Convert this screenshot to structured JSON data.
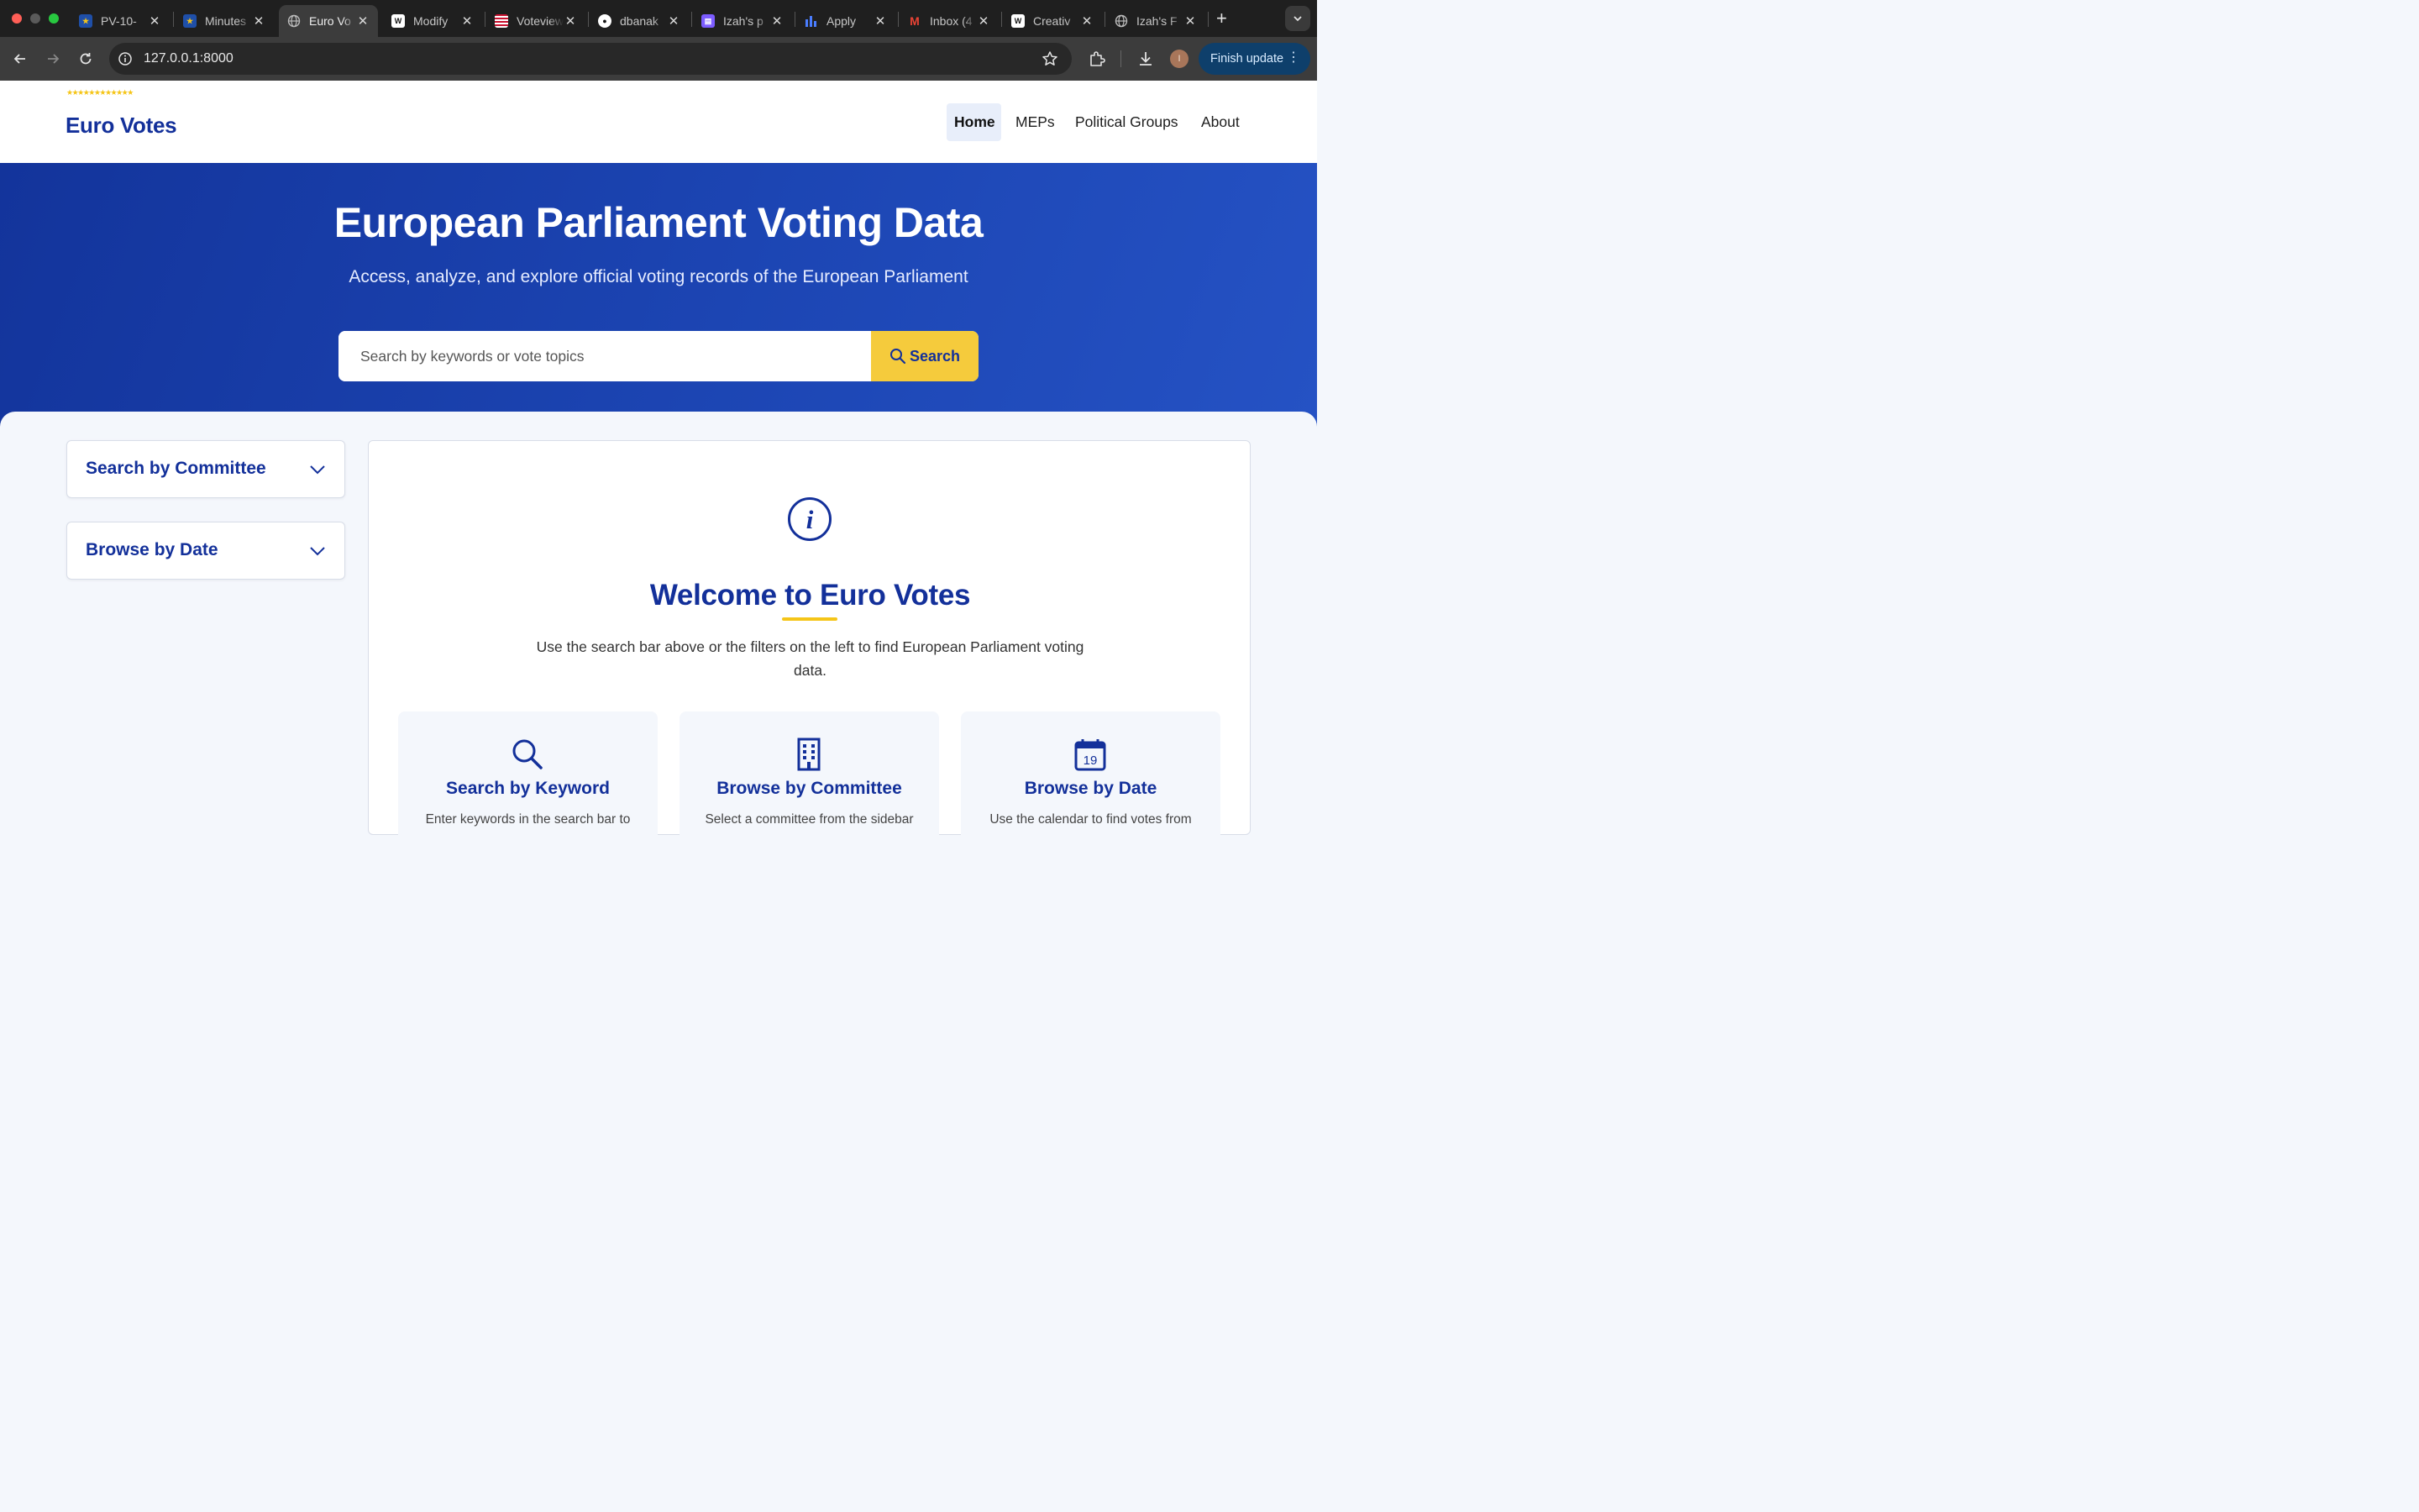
{
  "browser": {
    "tabs": [
      {
        "title": "PV-10-",
        "icon": "eu-flag-icon"
      },
      {
        "title": "Minutes",
        "icon": "eu-flag-icon"
      },
      {
        "title": "Euro Vo",
        "icon": "globe-icon",
        "active": true
      },
      {
        "title": "Modify",
        "icon": "webflow-icon"
      },
      {
        "title": "Voteview",
        "icon": "us-flag-icon"
      },
      {
        "title": "dbanak",
        "icon": "github-icon"
      },
      {
        "title": "Izah's p",
        "icon": "calendar-app-icon"
      },
      {
        "title": "Apply",
        "icon": "bar-chart-icon"
      },
      {
        "title": "Inbox (4",
        "icon": "gmail-icon"
      },
      {
        "title": "Creativ",
        "icon": "webflow-icon"
      },
      {
        "title": "Izah's F",
        "icon": "globe-icon"
      }
    ],
    "new_tab": "+",
    "url": "127.0.0.1:8000",
    "update_button": "Finish update"
  },
  "site": {
    "brand": "Euro Votes",
    "nav": [
      {
        "label": "Home",
        "active": true
      },
      {
        "label": "MEPs"
      },
      {
        "label": "Political Groups"
      },
      {
        "label": "About"
      }
    ]
  },
  "hero": {
    "title": "European Parliament Voting Data",
    "subtitle": "Access, analyze, and explore official voting records of the European Parliament",
    "search_placeholder": "Search by keywords or vote topics",
    "search_button": "Search"
  },
  "sidebar": {
    "sections": [
      {
        "title": "Search by Committee"
      },
      {
        "title": "Browse by Date"
      }
    ]
  },
  "welcome": {
    "title": "Welcome to Euro Votes",
    "text": "Use the search bar above or the filters on the left to find European Parliament voting data.",
    "cards": [
      {
        "title": "Search by Keyword",
        "text": "Enter keywords in the search bar to",
        "icon": "search-icon"
      },
      {
        "title": "Browse by Committee",
        "text": "Select a committee from the sidebar",
        "icon": "building-icon"
      },
      {
        "title": "Browse by Date",
        "text": "Use the calendar to find votes from",
        "icon": "calendar-icon",
        "icon_label": "19"
      }
    ]
  },
  "colors": {
    "brand_blue": "#13309a",
    "accent_yellow": "#f5cb3c",
    "hero_blue": "#1c45b3"
  }
}
